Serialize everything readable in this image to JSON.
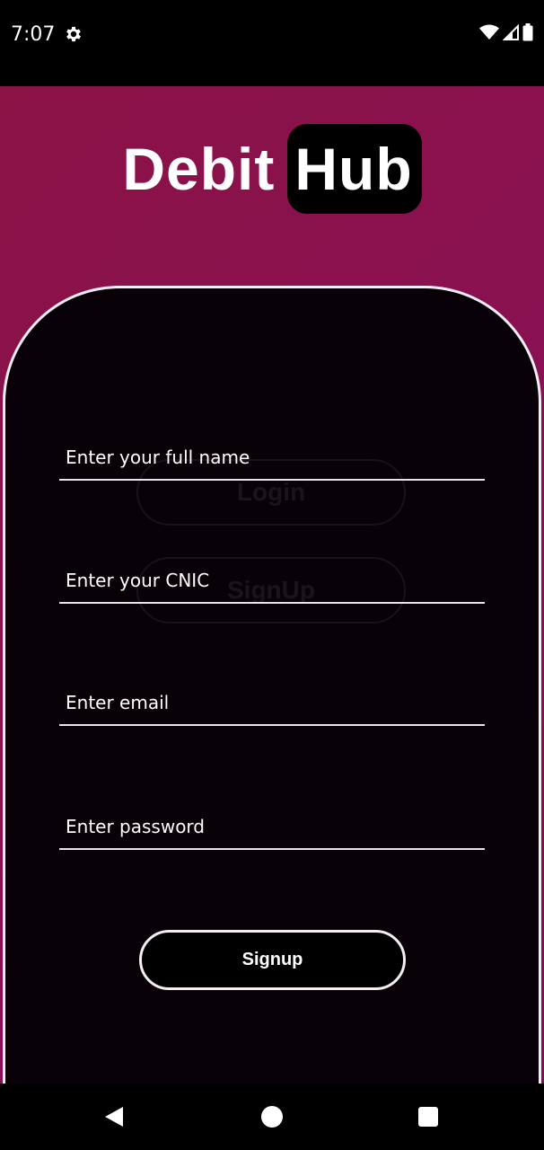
{
  "status_bar": {
    "time": "7:07",
    "icons": [
      "settings-gear-icon",
      "wifi-icon",
      "cellular-signal-icon",
      "battery-icon"
    ]
  },
  "logo": {
    "part1": "Debit",
    "part2": "Hub"
  },
  "background_buttons": {
    "login_label": "Login",
    "signup_label": "SignUp"
  },
  "form": {
    "full_name": {
      "placeholder": "Enter your full name",
      "value": ""
    },
    "cnic": {
      "placeholder": "Enter your CNIC",
      "value": ""
    },
    "email": {
      "placeholder": "Enter email",
      "value": ""
    },
    "password": {
      "placeholder": "Enter password",
      "value": ""
    },
    "submit_label": "Signup"
  },
  "colors": {
    "hero_gradient_start": "#8a1245",
    "hero_gradient_end": "#840e5c",
    "panel_background": "#080208",
    "accent_white": "#ffffff"
  },
  "nav_bar": {
    "icons": [
      "back-icon",
      "home-icon",
      "recents-icon"
    ]
  }
}
